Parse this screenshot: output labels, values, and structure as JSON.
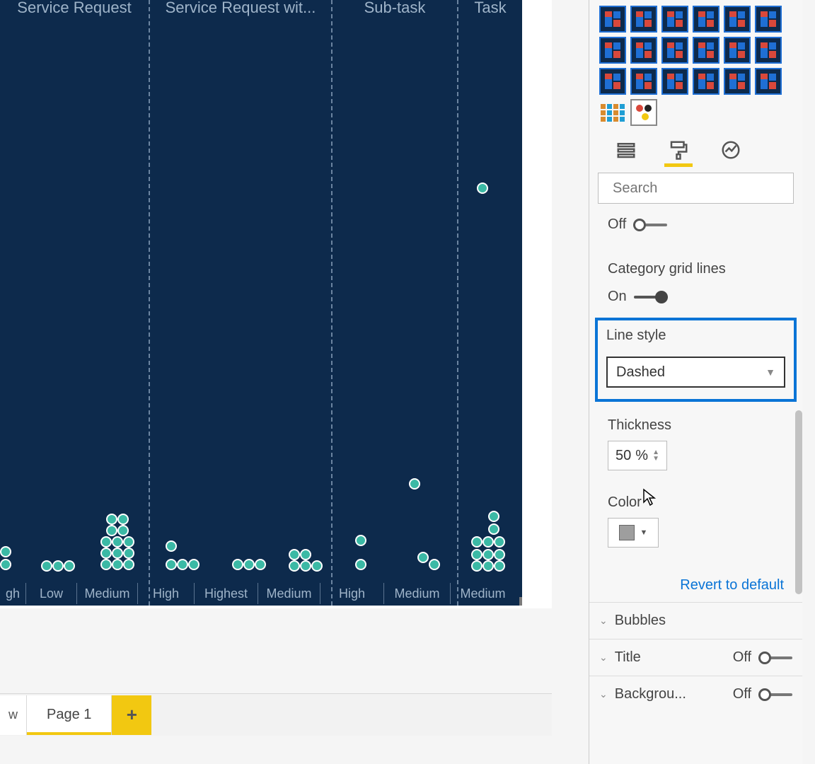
{
  "chart": {
    "columns": [
      "Service Request",
      "Service Request wit...",
      "Sub-task",
      "Task"
    ],
    "x_labels": [
      "gh",
      "Low",
      "Medium",
      "High",
      "Highest",
      "Medium",
      "High",
      "Medium",
      "Medium"
    ]
  },
  "tabs": {
    "partial": "w",
    "page1": "Page 1",
    "add": "+"
  },
  "panel": {
    "search_placeholder": "Search",
    "off_label": "Off",
    "category_grid_label": "Category grid lines",
    "on_label": "On",
    "line_style_label": "Line style",
    "line_style_value": "Dashed",
    "thickness_label": "Thickness",
    "thickness_value": "50",
    "thickness_unit": "%",
    "color_label": "Color",
    "revert": "Revert to default",
    "accordion_bubbles": "Bubbles",
    "accordion_title": "Title",
    "accordion_title_state": "Off",
    "accordion_background": "Backgrou...",
    "accordion_background_state": "Off"
  }
}
